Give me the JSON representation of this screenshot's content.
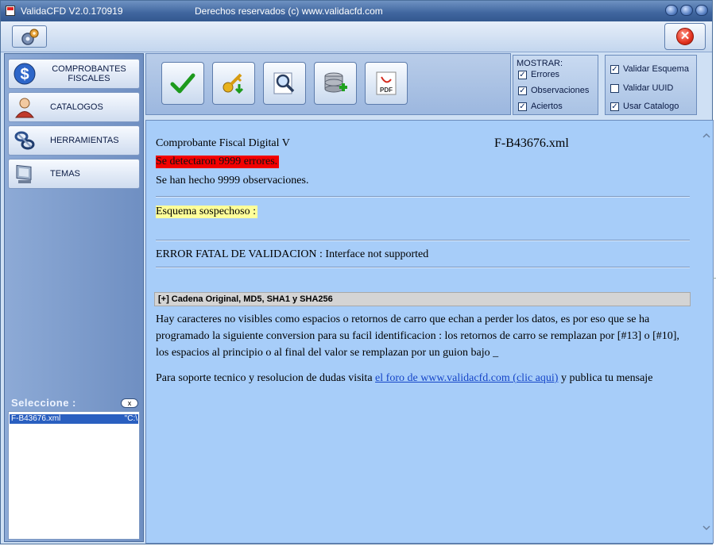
{
  "window": {
    "title": "ValidaCFD V2.0.170919",
    "subtitle": "Derechos reservados (c) www.validacfd.com"
  },
  "sidebar": {
    "items": [
      {
        "label": "COMPROBANTES FISCALES",
        "icon": "dollar-icon"
      },
      {
        "label": "CATALOGOS",
        "icon": "user-icon"
      },
      {
        "label": "HERRAMIENTAS",
        "icon": "tools-icon"
      },
      {
        "label": "TEMAS",
        "icon": "monitor-icon"
      }
    ],
    "seleccione_label": "Seleccione :",
    "close_label": "x",
    "files": [
      {
        "name": "F-B43676.xml",
        "path": "\"C:\\"
      }
    ]
  },
  "toolbar": {
    "buttons": [
      "validate-check",
      "key-download",
      "search",
      "database-add",
      "pdf"
    ],
    "pdf_label": "PDF"
  },
  "mostrar": {
    "title": "MOSTRAR:",
    "options": [
      {
        "label": "Errores",
        "checked": true
      },
      {
        "label": "Observaciones",
        "checked": true
      },
      {
        "label": "Aciertos",
        "checked": true
      }
    ]
  },
  "validar": {
    "options": [
      {
        "label": "Validar Esquema",
        "checked": true
      },
      {
        "label": "Validar UUID",
        "checked": false
      },
      {
        "label": "Usar Catalogo",
        "checked": true
      }
    ]
  },
  "content": {
    "title": "Comprobante Fiscal Digital V",
    "file": "F-B43676.xml",
    "errors": "Se detectaron 9999 errores.",
    "observations": "Se han hecho 9999 observaciones.",
    "esquema": "Esquema sospechoso :",
    "fatal": "ERROR FATAL DE VALIDACION : Interface not supported",
    "section_header": "[+] Cadena Original, MD5, SHA1 y SHA256",
    "paragraph": "Hay caracteres no visibles como espacios o retornos de carro que echan a perder los datos, es por eso que se ha programado la siguiente conversion para su facil identificacion : los retornos de carro se remplazan por [#13] o [#10], los espacios al principio o al final del valor se remplazan por un guion bajo _",
    "support_prefix": "Para soporte tecnico y resolucion de dudas visita ",
    "support_link": "el foro de www.validacfd.com (clic aqui)",
    "support_suffix": " y publica tu mensaje"
  }
}
